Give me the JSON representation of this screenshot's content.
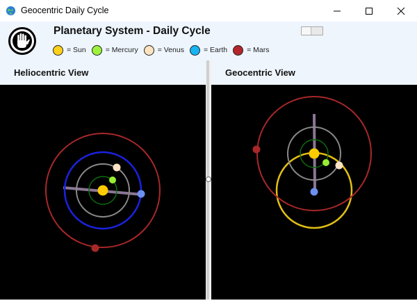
{
  "window": {
    "title": "Geocentric Daily Cycle"
  },
  "header": {
    "title": "Planetary System - Daily Cycle",
    "legend": [
      {
        "label": "= Sun",
        "color": "#ffd11a"
      },
      {
        "label": "= Mercury",
        "color": "#9cf23c"
      },
      {
        "label": "= Venus",
        "color": "#fde3c0"
      },
      {
        "label": "= Earth",
        "color": "#17b3f2"
      },
      {
        "label": "= Mars",
        "color": "#b3262b"
      }
    ]
  },
  "views": {
    "heliocentric": {
      "title": "Heliocentric View"
    },
    "geocentric": {
      "title": "Geocentric View"
    }
  },
  "colors": {
    "sun": "#ffcc00",
    "mercury": "#99ee33",
    "venus": "#fde3c4",
    "earth": "#6d8ff0",
    "mars": "#a82828",
    "orbit_mercury": "#0e6b0e",
    "orbit_venus": "#8a8a8a",
    "orbit_earth": "#1a22e0",
    "orbit_mars": "#a82828",
    "orbit_sun": "#e2bf14",
    "axis": "#8a7694"
  }
}
